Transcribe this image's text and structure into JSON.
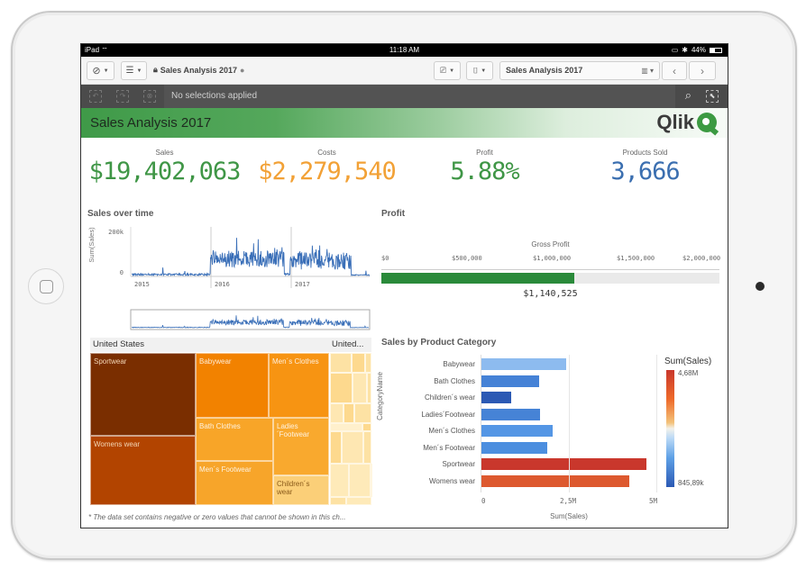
{
  "device": {
    "home_button": "home-button",
    "camera": "front-camera"
  },
  "status_bar": {
    "device": "iPad",
    "time": "11:18 AM",
    "battery": "44%",
    "battery_level": 0.44
  },
  "toolbar": {
    "app_title": "Sales Analysis 2017",
    "sheet_name": "Sales Analysis 2017",
    "icons": [
      "compass-icon",
      "list-icon",
      "lock-icon",
      "globe-icon",
      "present-icon",
      "bookmark-icon",
      "sheet-icon",
      "prev-arrow",
      "next-arrow"
    ]
  },
  "selections": {
    "text": "No selections applied"
  },
  "banner": {
    "title": "Sales Analysis 2017",
    "logo": "Qlik"
  },
  "kpis": [
    {
      "label": "Sales",
      "value": "$19,402,063",
      "color": "#3f9646"
    },
    {
      "label": "Costs",
      "value": "$2,279,540",
      "color": "#f2a136"
    },
    {
      "label": "Profit",
      "value": "5.88%",
      "color": "#3f9646"
    },
    {
      "label": "Products Sold",
      "value": "3,666",
      "color": "#3b6fb0"
    }
  ],
  "sales_over_time": {
    "title": "Sales over time",
    "ylabel": "Sum(Sales)",
    "yticks": [
      "200k",
      "0"
    ],
    "xticks": [
      "2015",
      "2016",
      "2017"
    ]
  },
  "profit": {
    "title": "Profit",
    "axis_title": "Gross Profit",
    "ticks": [
      "$0",
      "$500,000",
      "$1,000,000",
      "$1,500,000",
      "$2,000,000"
    ],
    "value_label": "$1,140,525",
    "value": 1140525,
    "max": 2000000,
    "color": "#2a8a3a"
  },
  "treemap": {
    "header_main": "United States",
    "header_other": "United...",
    "cells": [
      {
        "label": "Sportwear",
        "color": "#7a2e00"
      },
      {
        "label": "Womens wear",
        "color": "#b24400"
      },
      {
        "label": "Babywear",
        "color": "#f28200"
      },
      {
        "label": "Men´s Clothes",
        "color": "#f79412"
      },
      {
        "label": "Bath Clothes",
        "color": "#f8a528"
      },
      {
        "label": "Ladies´Footwear",
        "color": "#f9a92e"
      },
      {
        "label": "Men´s Footwear",
        "color": "#f7a52a"
      },
      {
        "label": "Children´s wear",
        "color": "#fbcf78"
      }
    ],
    "footnote": "* The data set contains negative or zero values that cannot be shown in this ch..."
  },
  "chart_data": {
    "type": "bar",
    "title": "Sales by Product Category",
    "xlabel": "Sum(Sales)",
    "ylabel": "CategoryName",
    "categories": [
      "Babywear",
      "Bath Clothes",
      "Children´s wear",
      "Ladies´Footwear",
      "Men´s Clothes",
      "Men´s Footwear",
      "Sportwear",
      "Womens wear"
    ],
    "values": [
      2400000,
      1650000,
      845890,
      1670000,
      2020000,
      1870000,
      4680000,
      4200000
    ],
    "xticks": [
      "0",
      "2,5M",
      "5M"
    ],
    "xlim": [
      0,
      5000000
    ],
    "legend": {
      "title": "Sum(Sales)",
      "max_label": "4,68M",
      "min_label": "845,89k",
      "placement": "right"
    }
  }
}
